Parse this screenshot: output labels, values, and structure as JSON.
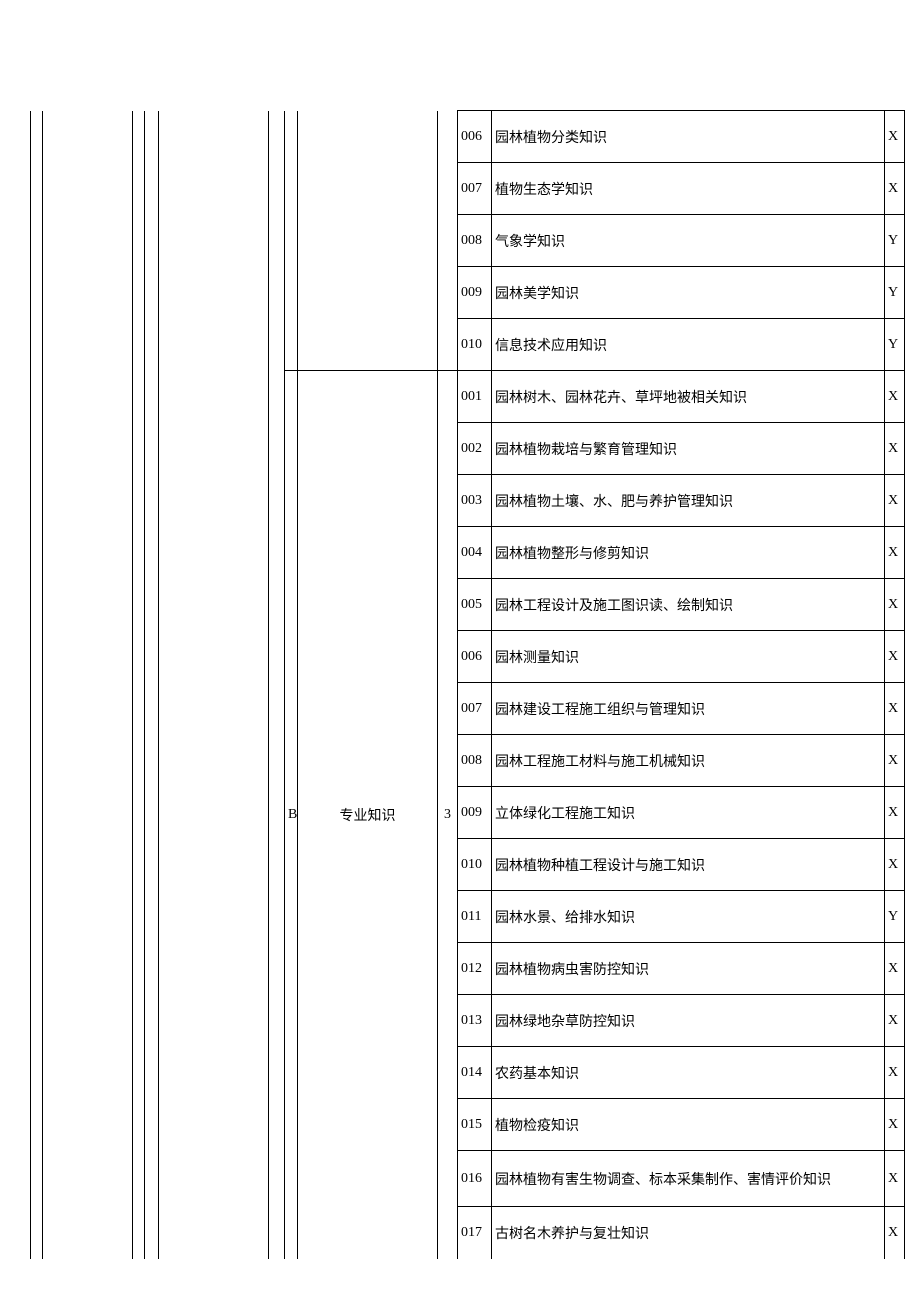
{
  "sectionB": {
    "code": "B",
    "title": "专业知识",
    "count": "3"
  },
  "topRows": [
    {
      "num": "006",
      "desc": "园林植物分类知识",
      "flag": "X"
    },
    {
      "num": "007",
      "desc": "植物生态学知识",
      "flag": "X"
    },
    {
      "num": "008",
      "desc": "气象学知识",
      "flag": "Y"
    },
    {
      "num": "009",
      "desc": "园林美学知识",
      "flag": "Y"
    },
    {
      "num": "010",
      "desc": "信息技术应用知识",
      "flag": "Y"
    }
  ],
  "bottomRows": [
    {
      "num": "001",
      "desc": "园林树木、园林花卉、草坪地被相关知识",
      "flag": "X"
    },
    {
      "num": "002",
      "desc": "园林植物栽培与繁育管理知识",
      "flag": "X"
    },
    {
      "num": "003",
      "desc": "园林植物土壤、水、肥与养护管理知识",
      "flag": "X"
    },
    {
      "num": "004",
      "desc": "园林植物整形与修剪知识",
      "flag": "X"
    },
    {
      "num": "005",
      "desc": "园林工程设计及施工图识读、绘制知识",
      "flag": "X"
    },
    {
      "num": "006",
      "desc": "园林测量知识",
      "flag": "X"
    },
    {
      "num": "007",
      "desc": "园林建设工程施工组织与管理知识",
      "flag": "X"
    },
    {
      "num": "008",
      "desc": "园林工程施工材料与施工机械知识",
      "flag": "X"
    },
    {
      "num": "009",
      "desc": "立体绿化工程施工知识",
      "flag": "X"
    },
    {
      "num": "010",
      "desc": "园林植物种植工程设计与施工知识",
      "flag": "X"
    },
    {
      "num": "011",
      "desc": "园林水景、给排水知识",
      "flag": "Y"
    },
    {
      "num": "012",
      "desc": "园林植物病虫害防控知识",
      "flag": "X"
    },
    {
      "num": "013",
      "desc": "园林绿地杂草防控知识",
      "flag": "X"
    },
    {
      "num": "014",
      "desc": "农药基本知识",
      "flag": "X"
    },
    {
      "num": "015",
      "desc": "植物检疫知识",
      "flag": "X"
    },
    {
      "num": "016",
      "desc": "园林植物有害生物调查、标本采集制作、害情评价知识",
      "flag": "X"
    },
    {
      "num": "017",
      "desc": "古树名木养护与复壮知识",
      "flag": "X"
    }
  ]
}
